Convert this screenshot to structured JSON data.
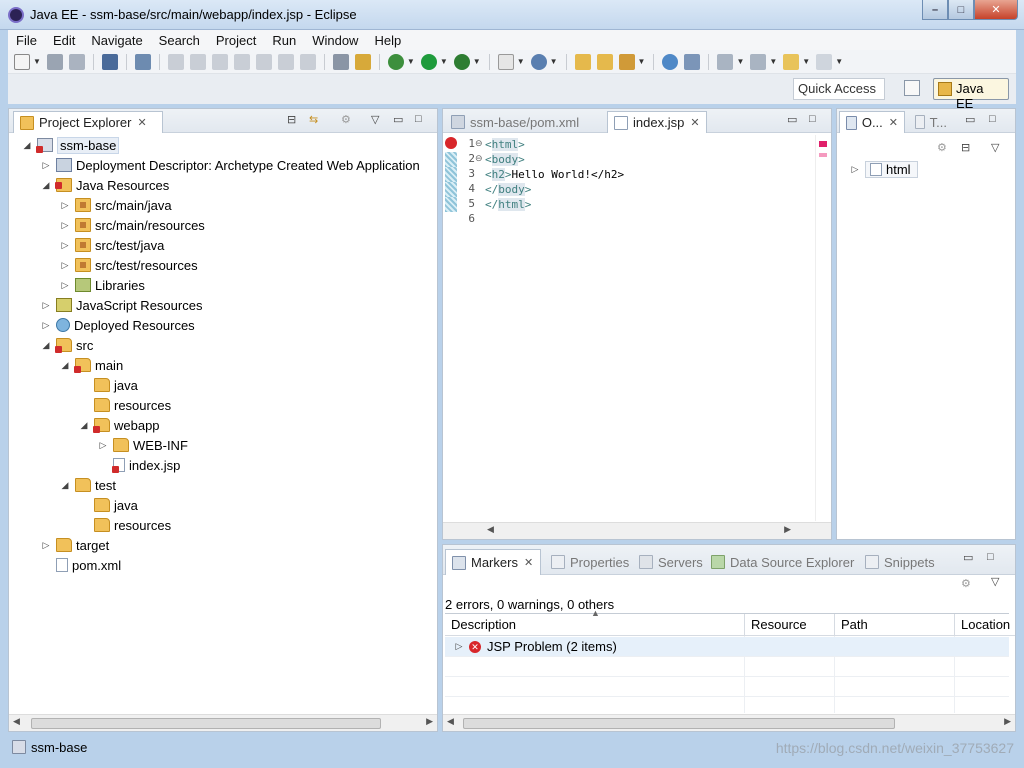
{
  "window": {
    "title": "Java EE - ssm-base/src/main/webapp/index.jsp - Eclipse",
    "min": "–",
    "max": "□",
    "close": "✕"
  },
  "menu": [
    "File",
    "Edit",
    "Navigate",
    "Search",
    "Project",
    "Run",
    "Window",
    "Help"
  ],
  "perspective": {
    "quick_access": "Quick Access",
    "active": "Java EE"
  },
  "project_explorer": {
    "tab_label": "Project Explorer",
    "tree": [
      {
        "label": "ssm-base",
        "depth": 0,
        "twisty": "◢",
        "icon": "project-error-icon",
        "selected": true
      },
      {
        "label": "Deployment Descriptor: Archetype Created Web Application",
        "depth": 1,
        "twisty": "▷",
        "icon": "deployment-descriptor-icon"
      },
      {
        "label": "Java Resources",
        "depth": 1,
        "twisty": "◢",
        "icon": "java-resources-error-icon"
      },
      {
        "label": "src/main/java",
        "depth": 2,
        "twisty": "▷",
        "icon": "source-folder-icon"
      },
      {
        "label": "src/main/resources",
        "depth": 2,
        "twisty": "▷",
        "icon": "source-folder-icon"
      },
      {
        "label": "src/test/java",
        "depth": 2,
        "twisty": "▷",
        "icon": "source-folder-icon"
      },
      {
        "label": "src/test/resources",
        "depth": 2,
        "twisty": "▷",
        "icon": "source-folder-icon"
      },
      {
        "label": "Libraries",
        "depth": 2,
        "twisty": "▷",
        "icon": "libraries-icon"
      },
      {
        "label": "JavaScript Resources",
        "depth": 1,
        "twisty": "▷",
        "icon": "javascript-resources-icon"
      },
      {
        "label": "Deployed Resources",
        "depth": 1,
        "twisty": "▷",
        "icon": "deployed-resources-icon"
      },
      {
        "label": "src",
        "depth": 1,
        "twisty": "◢",
        "icon": "folder-error-icon"
      },
      {
        "label": "main",
        "depth": 2,
        "twisty": "◢",
        "icon": "folder-error-icon"
      },
      {
        "label": "java",
        "depth": 3,
        "twisty": "",
        "icon": "folder-icon"
      },
      {
        "label": "resources",
        "depth": 3,
        "twisty": "",
        "icon": "folder-icon"
      },
      {
        "label": "webapp",
        "depth": 3,
        "twisty": "◢",
        "icon": "folder-error-icon"
      },
      {
        "label": "WEB-INF",
        "depth": 4,
        "twisty": "▷",
        "icon": "folder-icon"
      },
      {
        "label": "index.jsp",
        "depth": 4,
        "twisty": "",
        "icon": "jsp-file-error-icon"
      },
      {
        "label": "test",
        "depth": 2,
        "twisty": "◢",
        "icon": "folder-icon"
      },
      {
        "label": "java",
        "depth": 3,
        "twisty": "",
        "icon": "folder-icon"
      },
      {
        "label": "resources",
        "depth": 3,
        "twisty": "",
        "icon": "folder-icon"
      },
      {
        "label": "target",
        "depth": 1,
        "twisty": "▷",
        "icon": "folder-icon"
      },
      {
        "label": "pom.xml",
        "depth": 1,
        "twisty": "",
        "icon": "maven-pom-icon"
      }
    ]
  },
  "editor": {
    "tabs": [
      {
        "label": "ssm-base/pom.xml",
        "active": false
      },
      {
        "label": "index.jsp",
        "active": true
      }
    ],
    "line_numbers": [
      "1",
      "2",
      "3",
      "4",
      "5",
      "6"
    ],
    "lines": [
      {
        "open": "<",
        "name": "html",
        "close": ">",
        "rest": ""
      },
      {
        "open": "<",
        "name": "body",
        "close": ">",
        "rest": ""
      },
      {
        "open": "<",
        "name": "h2",
        "close": ">",
        "rest": "Hello World!</h2>"
      },
      {
        "open": "</",
        "name": "body",
        "close": ">",
        "rest": ""
      },
      {
        "open": "</",
        "name": "html",
        "close": ">",
        "rest": ""
      },
      {
        "open": "",
        "name": "",
        "close": "",
        "rest": ""
      }
    ]
  },
  "outline": {
    "tab_label": "O...",
    "tab2_label": "T...",
    "root": "html"
  },
  "markers": {
    "tabs": [
      "Markers",
      "Properties",
      "Servers",
      "Data Source Explorer",
      "Snippets"
    ],
    "summary": "2 errors, 0 warnings, 0 others",
    "columns": [
      "Description",
      "Resource",
      "Path",
      "Location"
    ],
    "rows": [
      {
        "description": "JSP Problem (2 items)"
      }
    ]
  },
  "status": {
    "text": "ssm-base"
  },
  "watermark": "https://blog.csdn.net/weixin_37753627",
  "colors": {
    "error": "#d8262a",
    "tag": "#3f7f7f",
    "selection": "#e6f0fa"
  }
}
